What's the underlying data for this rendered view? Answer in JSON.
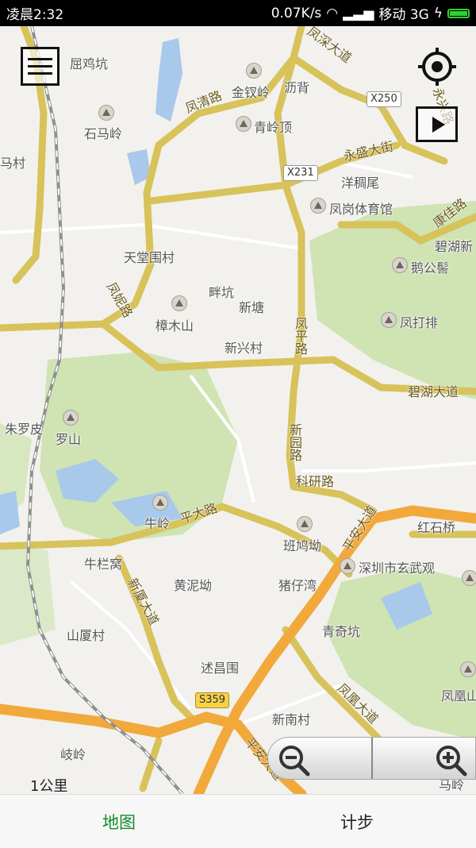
{
  "status_bar": {
    "time": "凌晨2:32",
    "network_speed": "0.07K/s",
    "carrier": "移动 3G"
  },
  "map": {
    "place_labels": [
      {
        "text": "屈鸡坑"
      },
      {
        "text": "石马岭"
      },
      {
        "text": "马村"
      },
      {
        "text": "金钗岭"
      },
      {
        "text": "沥背"
      },
      {
        "text": "青岭顶"
      },
      {
        "text": "洋稠尾"
      },
      {
        "text": "凤岗体育馆"
      },
      {
        "text": "碧湖新"
      },
      {
        "text": "鹅公髻"
      },
      {
        "text": "天堂围村"
      },
      {
        "text": "畔坑"
      },
      {
        "text": "新塘"
      },
      {
        "text": "樟木山"
      },
      {
        "text": "凤打排"
      },
      {
        "text": "新兴村"
      },
      {
        "text": "朱罗皮"
      },
      {
        "text": "罗山"
      },
      {
        "text": "牛岭"
      },
      {
        "text": "班鸠坳"
      },
      {
        "text": "红石桥"
      },
      {
        "text": "牛栏窝"
      },
      {
        "text": "黄泥坳"
      },
      {
        "text": "猪仔湾"
      },
      {
        "text": "深圳市玄武观"
      },
      {
        "text": "山厦村"
      },
      {
        "text": "青奇坑"
      },
      {
        "text": "凤凰山"
      },
      {
        "text": "述昌围"
      },
      {
        "text": "新南村"
      },
      {
        "text": "岐岭"
      },
      {
        "text": "马岭"
      }
    ],
    "road_labels": [
      {
        "text": "凤深大道"
      },
      {
        "text": "凤清路"
      },
      {
        "text": "永盛大街"
      },
      {
        "text": "康佳路"
      },
      {
        "text": "凤妮路"
      },
      {
        "text": "凤平路"
      },
      {
        "text": "碧湖大道"
      },
      {
        "text": "新园路"
      },
      {
        "text": "科研路"
      },
      {
        "text": "平大路"
      },
      {
        "text": "新厦大道"
      },
      {
        "text": "凤凰大道"
      },
      {
        "text": "平安大道"
      },
      {
        "text": "永兴路"
      },
      {
        "text": "平安大道"
      }
    ],
    "shields": {
      "x250": "X250",
      "x231": "X231",
      "s359": "S359"
    },
    "scale_label": "1公里"
  },
  "controls": {
    "menu_icon": "menu-icon",
    "locate_icon": "locate-icon",
    "play_icon": "play-icon",
    "zoom_out_icon": "zoom-out-icon",
    "zoom_in_icon": "zoom-in-icon"
  },
  "tabs": [
    {
      "label": "地图",
      "color": "#138a2a"
    },
    {
      "label": "计步",
      "color": "#222222"
    }
  ]
}
